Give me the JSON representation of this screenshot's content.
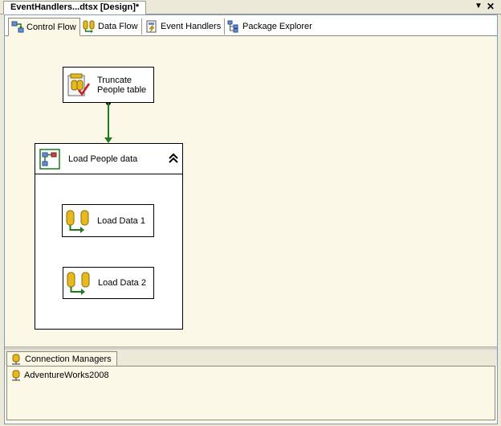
{
  "document_tab": {
    "title": "EventHandlers...dtsx [Design]*"
  },
  "window_controls": {
    "dropdown_icon": "dropdown-arrow-icon",
    "close_icon": "close-icon"
  },
  "designer_tabs": [
    {
      "label": "Control Flow",
      "icon": "control-flow-icon",
      "active": true
    },
    {
      "label": "Data Flow",
      "icon": "data-flow-icon",
      "active": false
    },
    {
      "label": "Event Handlers",
      "icon": "event-handlers-icon",
      "active": false
    },
    {
      "label": "Package Explorer",
      "icon": "package-explorer-icon",
      "active": false
    }
  ],
  "control_flow": {
    "truncate_task": {
      "label_line1": "Truncate",
      "label_line2": "People table",
      "icon": "execute-sql-task-icon"
    },
    "sequence_container": {
      "label": "Load People data",
      "icon": "sequence-container-icon",
      "collapse_icon": "double-chevron-up-icon"
    },
    "data_flow_tasks": [
      {
        "label": "Load Data 1",
        "icon": "data-flow-task-icon"
      },
      {
        "label": "Load Data 2",
        "icon": "data-flow-task-icon"
      }
    ],
    "precedence_color": "#1f7a1f"
  },
  "connection_managers": {
    "tab_label": "Connection Managers",
    "items": [
      {
        "label": "AdventureWorks2008",
        "icon": "connection-manager-icon"
      }
    ]
  }
}
